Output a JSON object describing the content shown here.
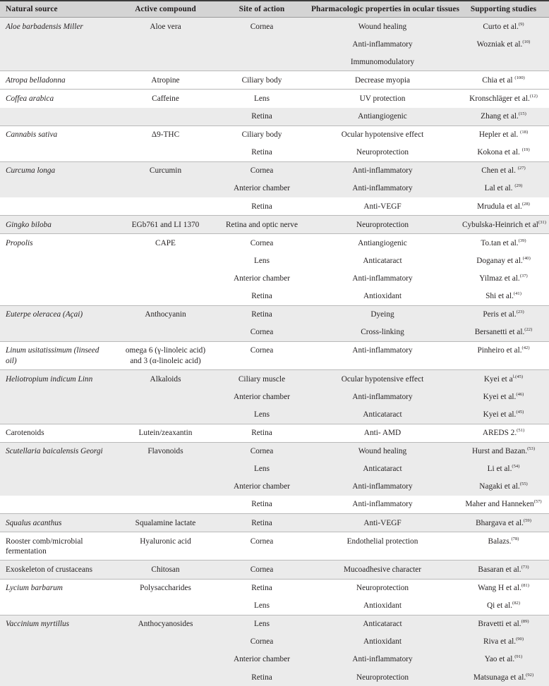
{
  "table": {
    "columns": [
      {
        "key": "natural_source",
        "label": "Natural source",
        "align": "left"
      },
      {
        "key": "active_compound",
        "label": "Active compound",
        "align": "center"
      },
      {
        "key": "site_of_action",
        "label": "Site of action",
        "align": "center"
      },
      {
        "key": "pharmacologic_properties",
        "label": "Pharmacologic properties in ocular tissues",
        "align": "center"
      },
      {
        "key": "supporting_studies",
        "label": "Supporting studies",
        "align": "center"
      }
    ],
    "header_bg": "#d4d4d4",
    "band_bg": "#ebebeb",
    "plain_bg": "#ffffff",
    "rule_color": "#b9b9b9",
    "top_border_color": "#3b3b3b",
    "text_color": "#231f20",
    "rows": [
      {
        "source": "Aloe barbadensis Miller",
        "source_italic": true,
        "compound": "Aloe vera",
        "site": "Cornea",
        "property": "Wound healing",
        "study": "Curto et al.",
        "ref": "(9)",
        "band": true,
        "rule": false
      },
      {
        "source": "",
        "source_italic": false,
        "compound": "",
        "site": "",
        "property": "Anti-inflammatory",
        "study": "Wozniak et al.",
        "ref": "(10)",
        "band": true,
        "rule": false
      },
      {
        "source": "",
        "source_italic": false,
        "compound": "",
        "site": "",
        "property": "Immunomodulatory",
        "study": "",
        "ref": "",
        "band": true,
        "rule": false
      },
      {
        "source": "Atropa belladonna",
        "source_italic": true,
        "compound": "Atropine",
        "site": "Ciliary body",
        "property": "Decrease myopia",
        "study": "Chia et al ",
        "ref": "(100)",
        "band": false,
        "rule": true
      },
      {
        "source": "Coffea arabica",
        "source_italic": true,
        "compound": "Caffeine",
        "site": "Lens",
        "property": "UV protection",
        "study": "Kronschläger et al.",
        "ref": "(12)",
        "band": false,
        "rule": true
      },
      {
        "source": "",
        "source_italic": false,
        "compound": "",
        "site": "Retina",
        "property": "Antiangiogenic",
        "study": "Zhang et al.",
        "ref": "(15)",
        "band": true,
        "rule": false
      },
      {
        "source": "Cannabis sativa",
        "source_italic": true,
        "compound": "Δ9-THC",
        "site": "Ciliary body",
        "property": "Ocular hypotensive effect",
        "study": "Hepler et al. ",
        "ref": "(18)",
        "band": false,
        "rule": true
      },
      {
        "source": "",
        "source_italic": false,
        "compound": "",
        "site": "Retina",
        "property": "Neuroprotection",
        "study": "Kokona et al. ",
        "ref": "(19)",
        "band": false,
        "rule": false
      },
      {
        "source": "Curcuma longa",
        "source_italic": true,
        "compound": "Curcumin",
        "site": "Cornea",
        "property": "Anti-inflammatory",
        "study": "Chen et al. ",
        "ref": "(27)",
        "band": true,
        "rule": true
      },
      {
        "source": "",
        "source_italic": false,
        "compound": "",
        "site": "Anterior chamber",
        "property": "Anti-inflammatory",
        "study": "Lal et al. ",
        "ref": "(29)",
        "band": true,
        "rule": false
      },
      {
        "source": "",
        "source_italic": false,
        "compound": "",
        "site": "Retina",
        "property": "Anti-VEGF",
        "study": "Mrudula et al.",
        "ref": "(28)",
        "band": false,
        "rule": false
      },
      {
        "source": "Gingko biloba",
        "source_italic": true,
        "compound": "EGb761 and LI 1370",
        "site": "Retina and optic nerve",
        "property": "Neuroprotection",
        "study": "Cybulska-Heinrich et al",
        "ref": "(31)",
        "band": true,
        "rule": true
      },
      {
        "source": "Propolis",
        "source_italic": true,
        "compound": "CAPE",
        "site": "Cornea",
        "property": "Antiangiogenic",
        "study": "To.tan et al.",
        "ref": "(39)",
        "band": false,
        "rule": true
      },
      {
        "source": "",
        "source_italic": false,
        "compound": "",
        "site": "Lens",
        "property": "Anticataract",
        "study": "Doganay et al.",
        "ref": "(40)",
        "band": false,
        "rule": false
      },
      {
        "source": "",
        "source_italic": false,
        "compound": "",
        "site": "Anterior chamber",
        "property": "Anti-inflammatory",
        "study": "Yilmaz et al.",
        "ref": "(37)",
        "band": false,
        "rule": false
      },
      {
        "source": "",
        "source_italic": false,
        "compound": "",
        "site": "Retina",
        "property": "Antioxidant",
        "study": "Shi et al.",
        "ref": "(41)",
        "band": false,
        "rule": false
      },
      {
        "source": "Euterpe oleracea (Açai)",
        "source_italic": true,
        "compound": "Anthocyanin",
        "site": "Retina",
        "property": "Dyeing",
        "study": "Peris et al.",
        "ref": "(23)",
        "band": true,
        "rule": true
      },
      {
        "source": "",
        "source_italic": false,
        "compound": "",
        "site": "Cornea",
        "property": "Cross-linking",
        "study": "Bersanetti et al.",
        "ref": "(22)",
        "band": true,
        "rule": false
      },
      {
        "source": "Linum usitatissimum (linseed oil)",
        "source_italic": true,
        "compound": "omega 6 (γ-linoleic acid)",
        "compound_line2": "and 3 (α-linoleic acid)",
        "site": "Cornea",
        "property": "Anti-inflammatory",
        "study": "Pinheiro et al.",
        "ref": "(42)",
        "band": false,
        "rule": true
      },
      {
        "source": "Heliotropium indicum Linn",
        "source_italic": true,
        "compound": "Alkaloids",
        "site": "Ciliary muscle",
        "property": "Ocular hypotensive effect",
        "study": "Kyei et a",
        "ref": "l.(45)",
        "band": true,
        "rule": true
      },
      {
        "source": "",
        "source_italic": false,
        "compound": "",
        "site": "Anterior chamber",
        "property": "Anti-inflammatory",
        "study": "Kyei et al.",
        "ref": "(46)",
        "band": true,
        "rule": false
      },
      {
        "source": "",
        "source_italic": false,
        "compound": "",
        "site": "Lens",
        "property": "Anticataract",
        "study": "Kyei et al.",
        "ref": "(45)",
        "band": true,
        "rule": false
      },
      {
        "source": "Carotenoids",
        "source_italic": false,
        "compound": "Lutein/zeaxantin",
        "site": "Retina",
        "property": "Anti- AMD",
        "study": "AREDS 2.",
        "ref": "(51)",
        "band": false,
        "rule": true
      },
      {
        "source": "Scutellaria baicalensis Georgi",
        "source_italic": true,
        "compound": "Flavonoids",
        "site": "Cornea",
        "property": "Wound healing",
        "study": "Hurst and Bazan.",
        "ref": "(53)",
        "band": true,
        "rule": true
      },
      {
        "source": "",
        "source_italic": false,
        "compound": "",
        "site": "Lens",
        "property": "Anticataract",
        "study": "Li et al.",
        "ref": "(54)",
        "band": true,
        "rule": false
      },
      {
        "source": "",
        "source_italic": false,
        "compound": "",
        "site": "Anterior chamber",
        "property": "Anti-inflammatory",
        "study": "Nagaki et al.",
        "ref": "(55)",
        "band": true,
        "rule": false
      },
      {
        "source": "",
        "source_italic": false,
        "compound": "",
        "site": "Retina",
        "property": "Anti-inflammatory",
        "study": "Maher and Hanneken",
        "ref": "(57)",
        "band": false,
        "rule": false
      },
      {
        "source": "Squalus acanthus",
        "source_italic": true,
        "compound": "Squalamine lactate",
        "site": "Retina",
        "property": "Anti-VEGF",
        "study": "Bhargava et al.",
        "ref": "(59)",
        "band": true,
        "rule": true
      },
      {
        "source": "Rooster comb/microbial",
        "source_line2": "fermentation",
        "source_italic": false,
        "compound": "Hyaluronic acid",
        "site": "Cornea",
        "property": "Endothelial protection",
        "study": "Balazs.",
        "ref": "(78)",
        "band": false,
        "rule": true
      },
      {
        "source": "Exoskeleton of crustaceans",
        "source_italic": false,
        "compound": "Chitosan",
        "site": "Cornea",
        "property": "Mucoadhesive character",
        "study": "Basaran et al.",
        "ref": "(73)",
        "band": true,
        "rule": true
      },
      {
        "source": "Lycium barbarum",
        "source_italic": true,
        "compound": "Polysaccharides",
        "site": "Retina",
        "property": "Neuroprotection",
        "study": "Wang H et al.",
        "ref": "(81)",
        "band": false,
        "rule": true
      },
      {
        "source": "",
        "source_italic": false,
        "compound": "",
        "site": "Lens",
        "property": "Antioxidant",
        "study": "Qi et al.",
        "ref": "(82)",
        "band": false,
        "rule": false
      },
      {
        "source": "Vaccinium myrtillus",
        "source_italic": true,
        "compound": "Anthocyanosides",
        "site": "Lens",
        "property": "Anticataract",
        "study": "Bravetti et al.",
        "ref": "(89)",
        "band": true,
        "rule": true
      },
      {
        "source": "",
        "source_italic": false,
        "compound": "",
        "site": "Cornea",
        "property": "Antioxidant",
        "study": "Riva et al.",
        "ref": "(90)",
        "band": true,
        "rule": false
      },
      {
        "source": "",
        "source_italic": false,
        "compound": "",
        "site": "Anterior chamber",
        "property": "Anti-inflammatory",
        "study": "Yao et al.",
        "ref": "(91)",
        "band": true,
        "rule": false
      },
      {
        "source": "",
        "source_italic": false,
        "compound": "",
        "site": "Retina",
        "property": "Neuroprotection",
        "study": "Matsunaga et al.",
        "ref": "(92)",
        "band": true,
        "rule": false
      }
    ]
  }
}
